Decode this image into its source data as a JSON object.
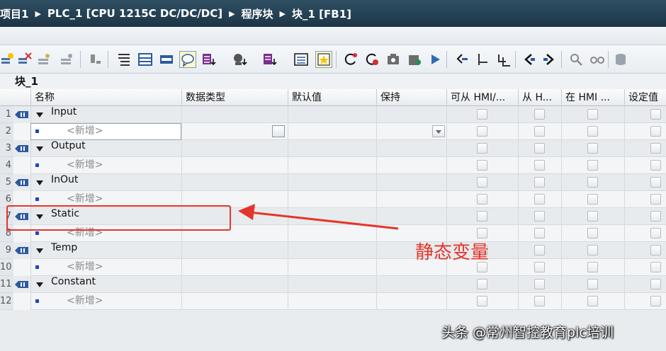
{
  "breadcrumb": [
    "项目1",
    "PLC_1 [CPU 1215C DC/DC/DC]",
    "程序块",
    "块_1 [FB1]"
  ],
  "block_name": "块_1",
  "columns": [
    "名称",
    "数据类型",
    "默认值",
    "保持",
    "可从 HMI/...",
    "从 H...",
    "在 HMI ...",
    "设定值"
  ],
  "row_numbers": [
    "1",
    "2",
    "3",
    "4",
    "5",
    "6",
    "7",
    "8",
    "9",
    "10",
    "11",
    "12"
  ],
  "sections": [
    {
      "name": "Input",
      "add_label": "<新增>"
    },
    {
      "name": "Output",
      "add_label": "<新增>"
    },
    {
      "name": "InOut",
      "add_label": "<新增>"
    },
    {
      "name": "Static",
      "add_label": "<新增>"
    },
    {
      "name": "Temp",
      "add_label": "<新增>"
    },
    {
      "name": "Constant",
      "add_label": "<新增>"
    }
  ],
  "annotation": {
    "label": "静态变量",
    "color": "#e5352a"
  },
  "watermark": "头条 @常州智控教育plc培训",
  "toolbar_icons": [
    "insert-row-icon",
    "delete-row-icon",
    "insert-row-above-icon",
    "insert-row-below-icon",
    "monitor-icon",
    "expand-icon",
    "collapse-icon",
    "block-icon",
    "comment-icon",
    "download-icon",
    "upload-icon",
    "compile-icon",
    "list-icon",
    "highlight-icon",
    "reset-icon",
    "stop-icon",
    "snapshot-icon",
    "load-icon",
    "start-value-icon",
    "compare-icon",
    "cross-ref-icon",
    "jump-back-icon",
    "jump-forward-icon",
    "search-icon",
    "binocular-icon",
    "database-icon"
  ]
}
